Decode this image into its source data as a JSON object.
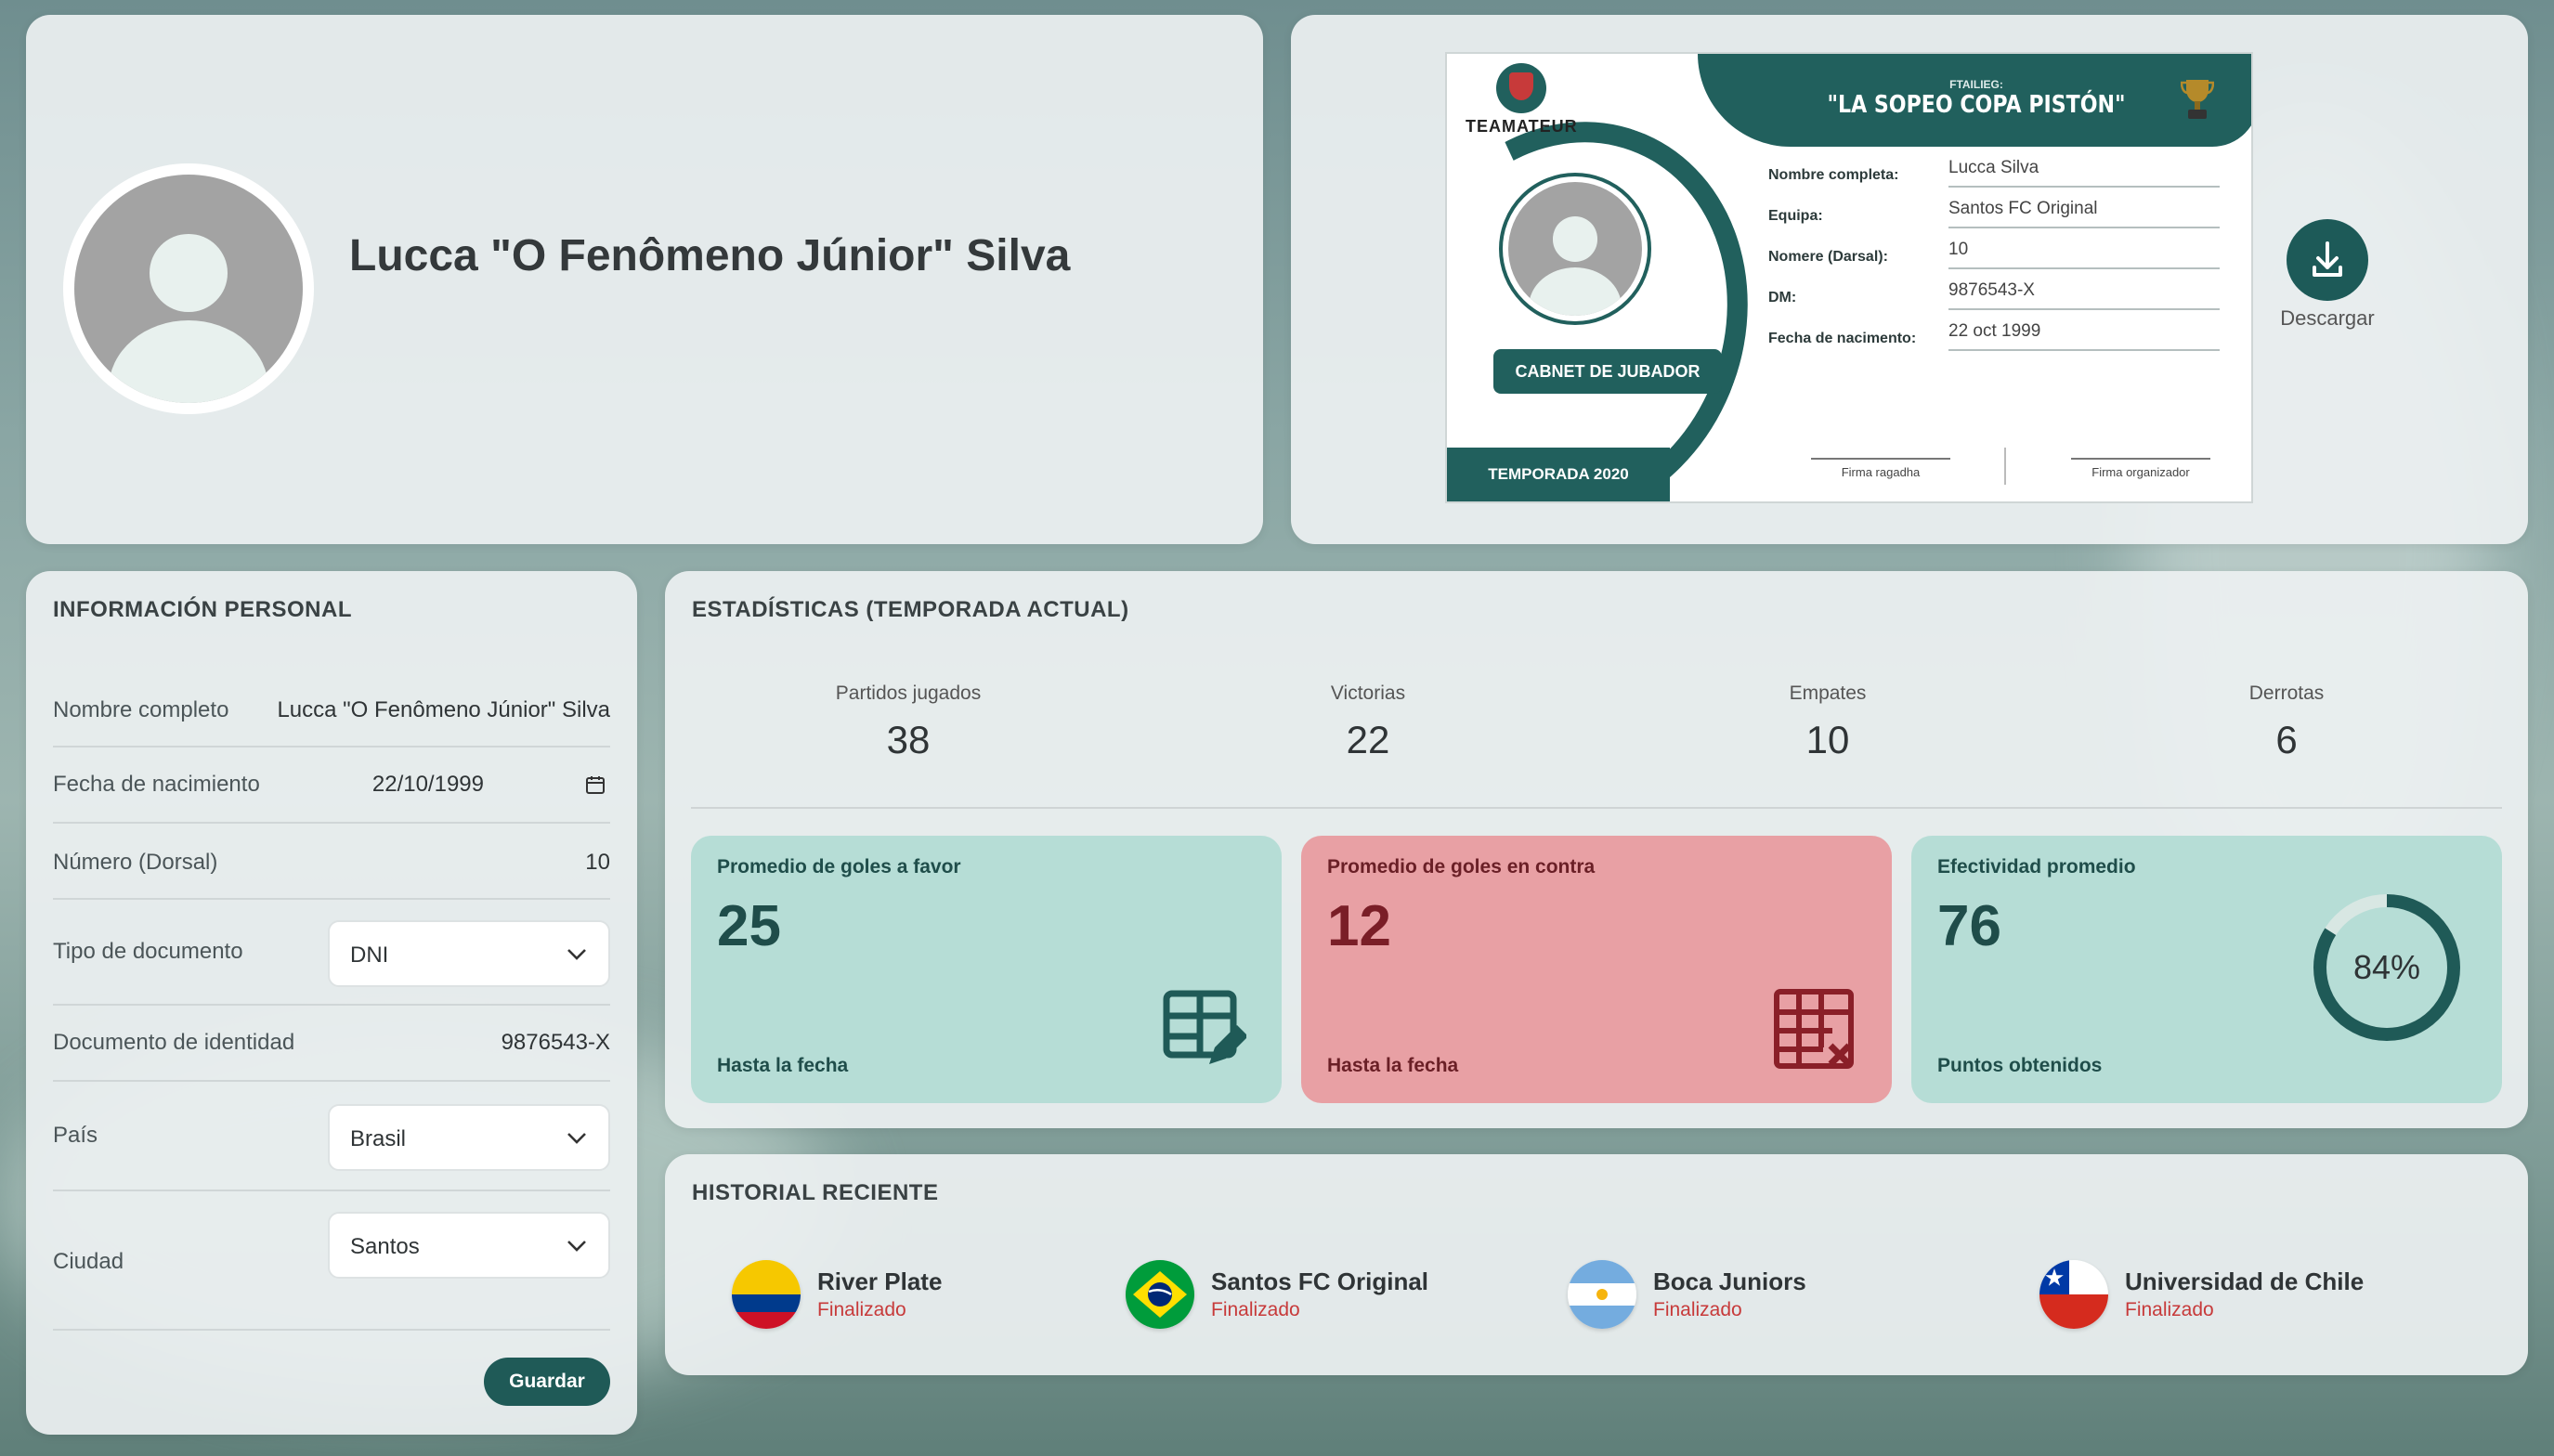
{
  "player": {
    "display_name": "Lucca \"O Fenômeno Júnior\" Silva"
  },
  "license_card": {
    "logo_text": "TEAMATEUR",
    "event_subtitle": "FTAILIEG:",
    "event_title": "\"LA SOPEO COPA PISTÓN\"",
    "badge_label": "CABNET DE JUBADOR",
    "season_label": "TEMPORADA 2020",
    "fields": [
      {
        "label": "Nombre completa:",
        "value": "Lucca Silva"
      },
      {
        "label": "Equipa:",
        "value": "Santos FC Original"
      },
      {
        "label": "Nomere (Darsal):",
        "value": "10"
      },
      {
        "label": "DM:",
        "value": "9876543-X"
      },
      {
        "label": "Fecha de nacimento:",
        "value": "22 oct 1999"
      }
    ],
    "signature_player": "Firma ragadha",
    "signature_organizer": "Firma organizador",
    "download_label": "Descargar"
  },
  "personal_info": {
    "title": "INFORMACIÓN PERSONAL",
    "full_name_label": "Nombre completo",
    "full_name_value": "Lucca \"O Fenômeno Júnior\" Silva",
    "birth_label": "Fecha de nacimiento",
    "birth_value": "22/10/1999",
    "number_label": "Número (Dorsal)",
    "number_value": "10",
    "doc_type_label": "Tipo de documento",
    "doc_type_value": "DNI",
    "doc_id_label": "Documento de identidad",
    "doc_id_value": "9876543-X",
    "country_label": "País",
    "country_value": "Brasil",
    "city_label": "Ciudad",
    "city_value": "Santos",
    "save_label": "Guardar"
  },
  "stats": {
    "title": "ESTADÍSTICAS (TEMPORADA ACTUAL)",
    "counters": [
      {
        "label": "Partidos jugados",
        "value": "38"
      },
      {
        "label": "Victorias",
        "value": "22"
      },
      {
        "label": "Empates",
        "value": "10"
      },
      {
        "label": "Derrotas",
        "value": "6"
      }
    ],
    "goals_for": {
      "title": "Promedio de goles a favor",
      "value": "25",
      "sub": "Hasta la fecha"
    },
    "goals_against": {
      "title": "Promedio de goles en contra",
      "value": "12",
      "sub": "Hasta la fecha"
    },
    "effectiveness": {
      "title": "Efectividad promedio",
      "value": "76",
      "sub": "Puntos obtenidos",
      "percent_label": "84%",
      "percent": 84
    }
  },
  "history": {
    "title": "HISTORIAL RECIENTE",
    "items": [
      {
        "name": "River Plate",
        "status": "Finalizado",
        "flag": "colombia-flag"
      },
      {
        "name": "Santos FC Original",
        "status": "Finalizado",
        "flag": "brazil-flag"
      },
      {
        "name": "Boca Juniors",
        "status": "Finalizado",
        "flag": "argentina-flag"
      },
      {
        "name": "Universidad de Chile",
        "status": "Finalizado",
        "flag": "chile-flag"
      }
    ]
  },
  "colors": {
    "primary": "#1f5a57",
    "tile_green": "#b6ddd6",
    "tile_red": "#e8a0a4",
    "status_red": "#c73a3a"
  }
}
